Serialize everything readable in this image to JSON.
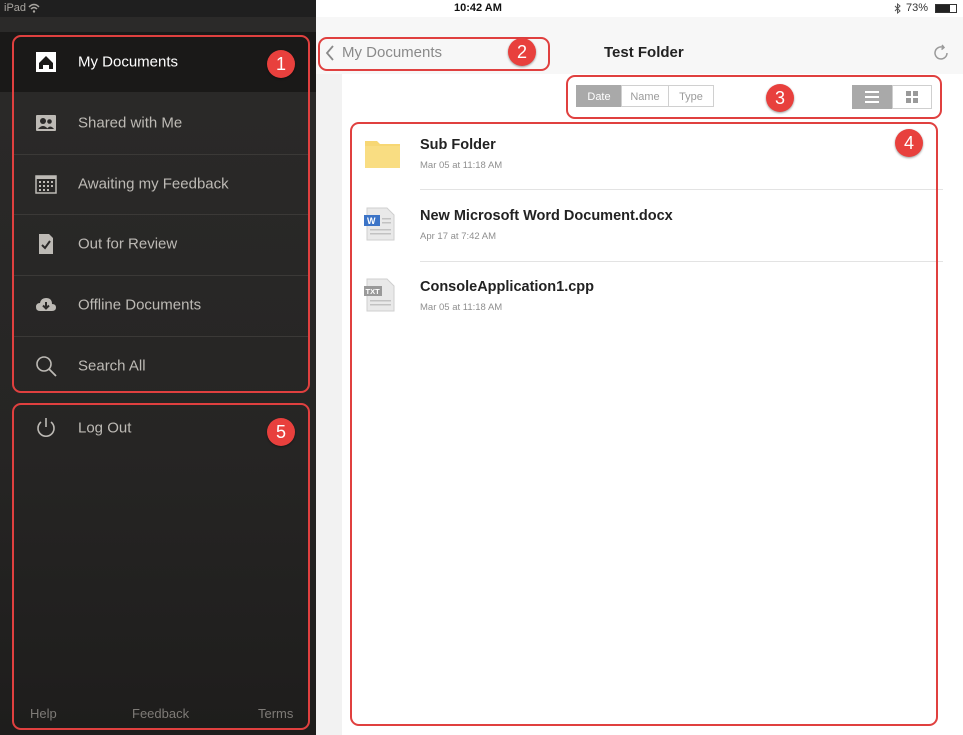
{
  "status_bar": {
    "device": "iPad",
    "time": "10:42 AM",
    "battery": "73%"
  },
  "sidebar": {
    "items": [
      {
        "label": "My Documents",
        "icon": "home-icon",
        "active": true
      },
      {
        "label": "Shared with Me",
        "icon": "shared-users-icon"
      },
      {
        "label": "Awaiting my Feedback",
        "icon": "calendar-grid-icon"
      },
      {
        "label": "Out for Review",
        "icon": "document-check-icon"
      },
      {
        "label": "Offline Documents",
        "icon": "cloud-download-icon"
      },
      {
        "label": "Search All",
        "icon": "search-icon"
      }
    ],
    "logout_label": "Log Out",
    "footer": {
      "help": "Help",
      "feedback": "Feedback",
      "terms": "Terms"
    }
  },
  "navbar": {
    "back_label": "My Documents",
    "title": "Test Folder"
  },
  "sort": {
    "options": [
      "Date",
      "Name",
      "Type"
    ],
    "selected": "Date"
  },
  "view_mode": {
    "selected": "list"
  },
  "files": [
    {
      "name": "Sub Folder",
      "date": "Mar 05 at 11:18 AM",
      "type": "folder"
    },
    {
      "name": "New Microsoft Word Document.docx",
      "date": "Apr 17 at 7:42 AM",
      "type": "word"
    },
    {
      "name": "ConsoleApplication1.cpp",
      "date": "Mar 05 at 11:18 AM",
      "type": "text"
    }
  ],
  "callouts": [
    "1",
    "2",
    "3",
    "4",
    "5"
  ],
  "colors": {
    "callout": "#e0403f",
    "sidebar_bg": "#262524",
    "active_bg": "#1a1918",
    "folder": "#f7d774"
  }
}
